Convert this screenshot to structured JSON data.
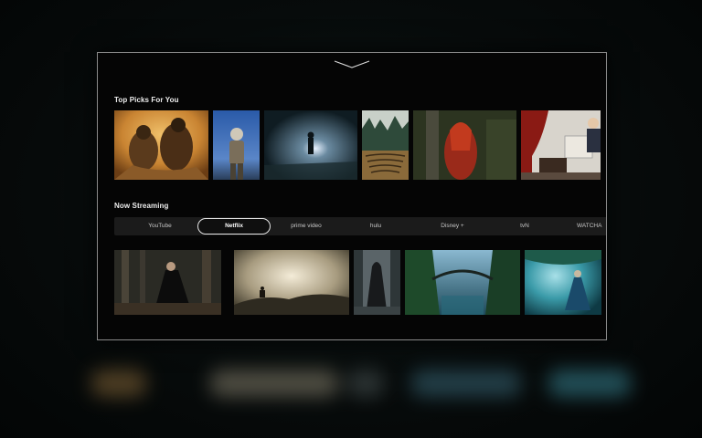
{
  "sections": {
    "top_picks": {
      "title": "Top Picks For You"
    },
    "now_streaming": {
      "title": "Now Streaming",
      "tabs": [
        "YouTube",
        "Netflix",
        "prime video",
        "hulu",
        "Disney +",
        "tvN",
        "WATCHA"
      ],
      "active_tab": "Netflix"
    }
  },
  "icons": {
    "collapse": "chevron-down-icon"
  },
  "colors": {
    "background": "#050505",
    "frame_border": "#8a8a8a",
    "tab_bar": "#1b1b1b",
    "active_tab_border": "#e6e6e6"
  }
}
